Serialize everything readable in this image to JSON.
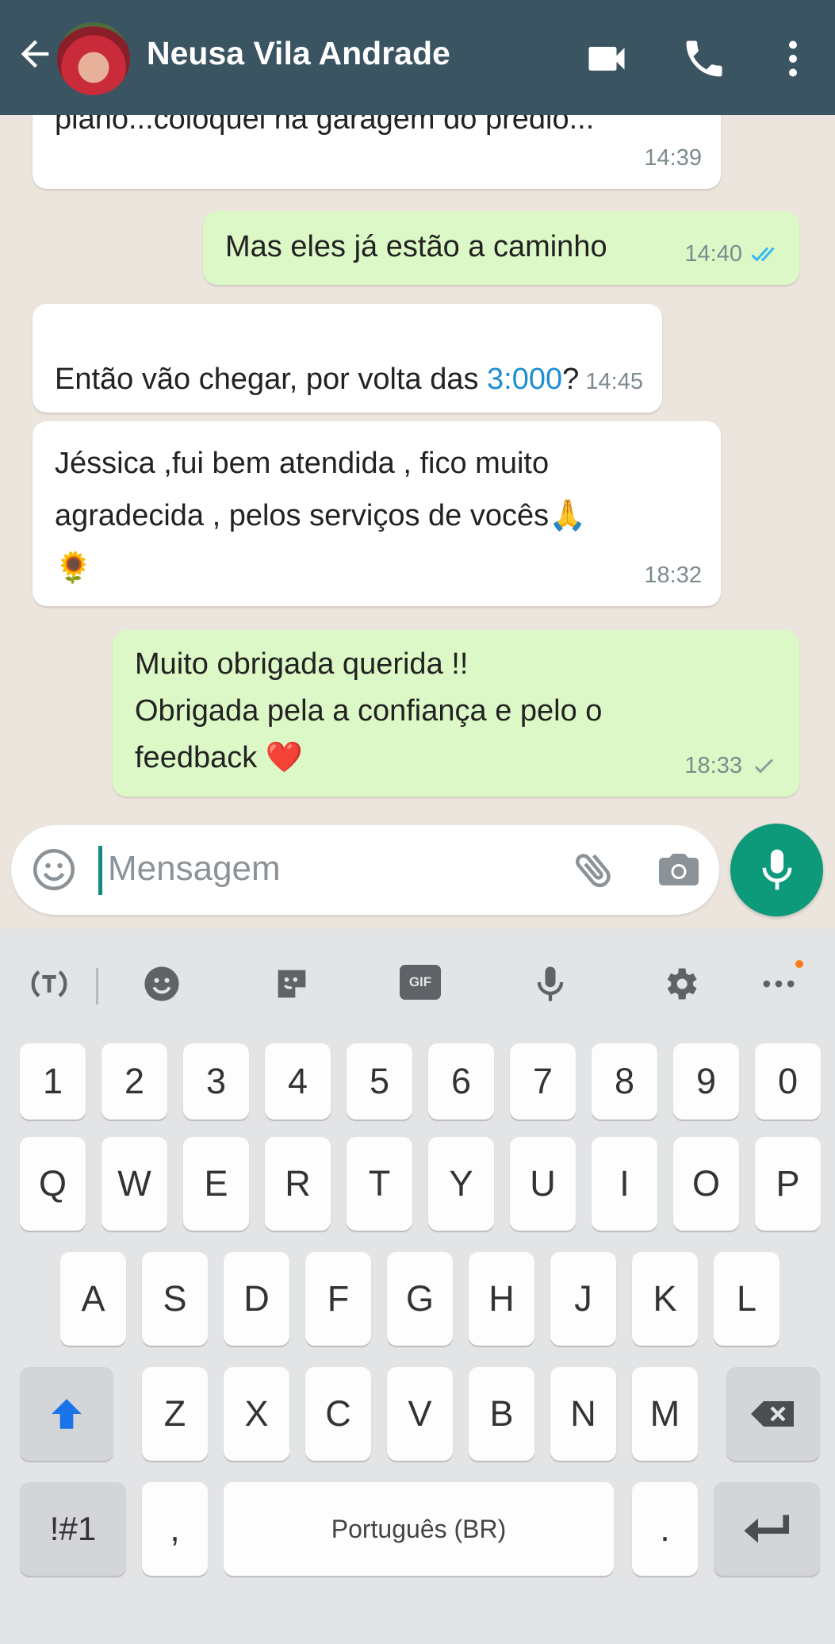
{
  "header": {
    "contact_name": "Neusa Vila Andrade",
    "icons": [
      "back-arrow-icon",
      "video-call-icon",
      "phone-icon",
      "more-vertical-icon"
    ],
    "color": "#3a5462"
  },
  "messages": [
    {
      "direction": "in",
      "text": "piano...coloquei na garagem do prédio...",
      "time": "14:39"
    },
    {
      "direction": "out",
      "text": "Mas eles já estão a caminho",
      "time": "14:40",
      "status": "read"
    },
    {
      "direction": "in",
      "text_before": "Então vão chegar, por volta das ",
      "link": "3:000",
      "text_after": "?",
      "time": "14:45"
    },
    {
      "direction": "in",
      "text": "Jéssica  ,fui bem atendida , fico muito\nagradecida , pelos serviços de vocês🙏\n🌻",
      "time": "18:32"
    },
    {
      "direction": "out",
      "text": "Muito obrigada querida !!\nObrigada pela a confiança e pelo o\nfeedback ❤️",
      "time": "18:33",
      "status": "sent"
    }
  ],
  "input": {
    "placeholder": "Mensagem",
    "icons": [
      "emoji-icon",
      "attach-icon",
      "camera-icon",
      "microphone-icon"
    ]
  },
  "keyboard": {
    "toolbar_icons": [
      "text-toggle-icon",
      "emoji-icon",
      "sticker-icon",
      "gif-icon",
      "voice-icon",
      "settings-icon",
      "more-icon"
    ],
    "gif_label": "GIF",
    "row_numbers": [
      "1",
      "2",
      "3",
      "4",
      "5",
      "6",
      "7",
      "8",
      "9",
      "0"
    ],
    "row1": [
      "Q",
      "W",
      "E",
      "R",
      "T",
      "Y",
      "U",
      "I",
      "O",
      "P"
    ],
    "row2": [
      "A",
      "S",
      "D",
      "F",
      "G",
      "H",
      "J",
      "K",
      "L"
    ],
    "row3": [
      "Z",
      "X",
      "C",
      "V",
      "B",
      "N",
      "M"
    ],
    "symbols_key": "!#1",
    "comma_key": ",",
    "space_label": "Português (BR)",
    "period_key": ".",
    "accent": "#1a73e8"
  }
}
